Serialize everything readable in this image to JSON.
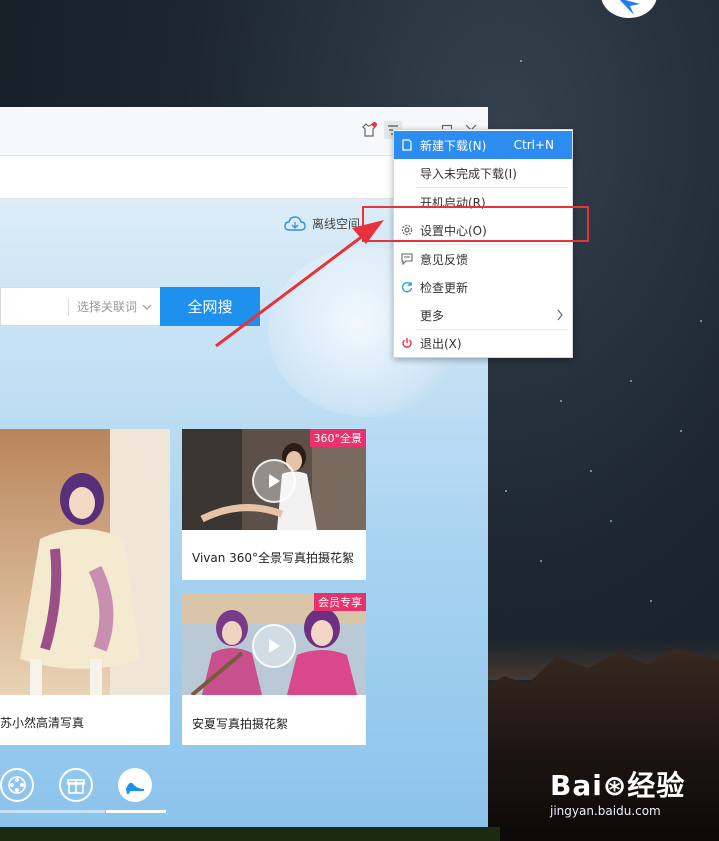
{
  "background": {
    "sky": "#1d2630"
  },
  "window": {
    "offline_label": "离线空间",
    "search": {
      "placeholder": "选择关联词",
      "button": "全网搜"
    },
    "cards": [
      {
        "caption": "苏小然高清写真",
        "badge": ""
      },
      {
        "caption": "Vivan 360°全景写真拍摄花絮",
        "badge": "360°全景"
      },
      {
        "caption": "安夏写真拍摄花絮",
        "badge": "会员专享"
      }
    ],
    "bottom_icons": [
      "film-reel-icon",
      "gift-icon",
      "high-heel-icon"
    ]
  },
  "menu": {
    "items": [
      {
        "label": "新建下载(N)",
        "shortcut": "Ctrl+N",
        "icon": "new-download-icon",
        "highlighted": true
      },
      {
        "label": "导入未完成下载(I)",
        "shortcut": "",
        "icon": ""
      },
      {
        "label": "开机启动(R)",
        "shortcut": "",
        "icon": ""
      },
      {
        "label": "设置中心(O)",
        "shortcut": "",
        "icon": "gear-icon"
      },
      {
        "label": "意见反馈",
        "shortcut": "",
        "icon": "feedback-icon"
      },
      {
        "label": "检查更新",
        "shortcut": "",
        "icon": "refresh-icon"
      },
      {
        "label": "更多",
        "shortcut": "",
        "icon": ""
      },
      {
        "label": "退出(X)",
        "shortcut": "",
        "icon": "power-icon"
      }
    ]
  },
  "watermark": {
    "brand": "Bai⊛经验",
    "url": "jingyan.baidu.com"
  },
  "colors": {
    "accent": "#1e90ee",
    "menu_highlight": "#2d8cf0",
    "annotation": "#e8323b",
    "badge": "#e8326b"
  }
}
